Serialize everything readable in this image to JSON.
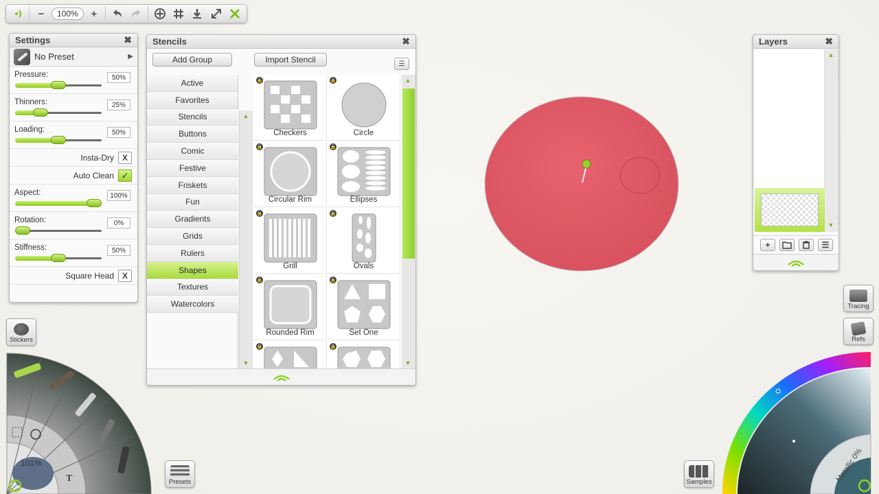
{
  "toolbar": {
    "zoom": "100%",
    "items": [
      "info-icon",
      "zoom-out",
      "zoom-in",
      "undo",
      "redo",
      "transform",
      "grid",
      "download",
      "fullscreen",
      "close"
    ]
  },
  "settings": {
    "title": "Settings",
    "preset": "No Preset",
    "sliders": [
      {
        "label": "Pressure:",
        "value": "50%",
        "level": 0.5
      },
      {
        "label": "Thinners:",
        "value": "25%",
        "level": 0.25
      },
      {
        "label": "Loading:",
        "value": "50%",
        "level": 0.5
      },
      {
        "label": "Aspect:",
        "value": "100%",
        "level": 1.0
      },
      {
        "label": "Rotation:",
        "value": "0%",
        "level": 0.0
      },
      {
        "label": "Stiffness:",
        "value": "50%",
        "level": 0.5
      }
    ],
    "insta_dry": {
      "label": "Insta-Dry",
      "mark": "X"
    },
    "auto_clean": {
      "label": "Auto Clean",
      "mark": "✓"
    },
    "square_head": {
      "label": "Square Head",
      "mark": "X"
    }
  },
  "stencils": {
    "title": "Stencils",
    "add_group": "Add Group",
    "import_stencil": "Import Stencil",
    "groups": [
      "Active",
      "Favorites",
      "Stencils",
      "Buttons",
      "Comic",
      "Festive",
      "Friskets",
      "Fun",
      "Gradients",
      "Grids",
      "Rulers",
      "Shapes",
      "Textures",
      "Watercolors"
    ],
    "selected_group": "Shapes",
    "tiles": [
      "Checkers",
      "Circle",
      "Circular Rim",
      "Ellipses",
      "Grill",
      "Ovals",
      "Rounded Rim",
      "Set One",
      "",
      ""
    ]
  },
  "layers": {
    "title": "Layers"
  },
  "side_buttons": {
    "stickers": "Stickers",
    "tracing": "Tracing",
    "refs": "Refs",
    "presets": "Presets",
    "samples": "Samples"
  },
  "tool_wheel": {
    "zoom_readout": "101%"
  },
  "color_wheel": {
    "metallic": "Metallic 0%"
  },
  "colors": {
    "accent": "#9fd533",
    "canvas_circle": "#e05a68"
  }
}
